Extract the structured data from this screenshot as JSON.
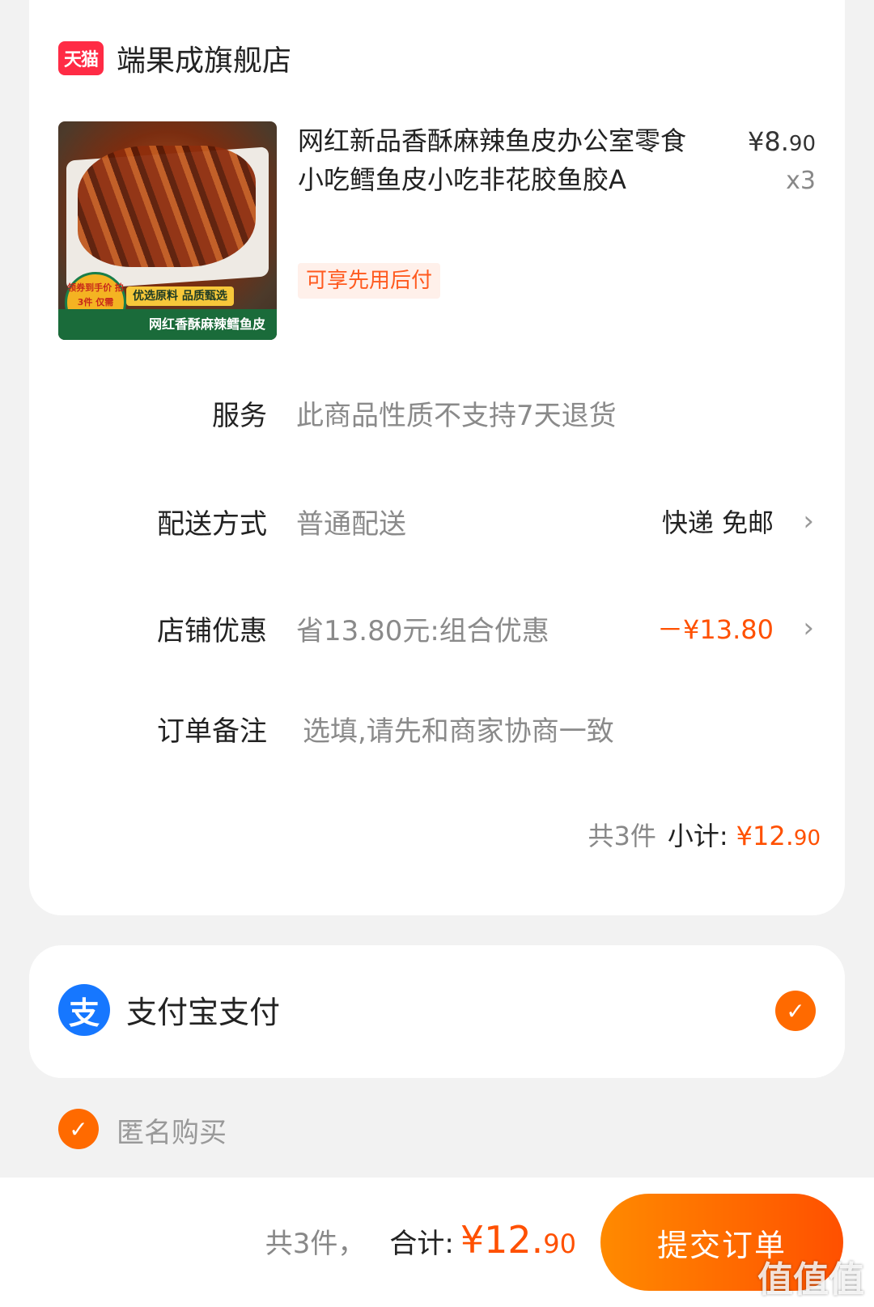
{
  "store": {
    "logo_text": "天猫",
    "name": "端果成旗舰店"
  },
  "product": {
    "title": "网红新品香酥麻辣鱼皮办公室零食小吃鳕鱼皮小吃非花胶鱼胶A",
    "price_yuan": "¥8.",
    "price_cents": "90",
    "quantity": "x3",
    "tag": "可享先用后付",
    "image_badge": "领券到手价 拍3件 仅需12.9",
    "image_tag": "优选原料 品质甄选",
    "image_caption": "网红香酥麻辣鳕鱼皮"
  },
  "rows": {
    "service": {
      "label": "服务",
      "value": "此商品性质不支持7天退货"
    },
    "delivery": {
      "label": "配送方式",
      "value": "普通配送",
      "right": "快递 免邮"
    },
    "discount": {
      "label": "店铺优惠",
      "value": "省13.80元:组合优惠",
      "right": "－¥13.80"
    },
    "note": {
      "label": "订单备注",
      "placeholder": "选填,请先和商家协商一致"
    }
  },
  "subtotal": {
    "count": "共3件",
    "label": "小计:",
    "amount": "¥12.",
    "cents": "90"
  },
  "payment": {
    "icon_text": "支",
    "label": "支付宝支付"
  },
  "anonymous": {
    "label": "匿名购买"
  },
  "bottom": {
    "count": "共3件，",
    "label": "合计:",
    "amount": "¥12.",
    "cents": "90",
    "submit": "提交订单"
  },
  "watermark": "值值值",
  "colors": {
    "accent": "#ff5000",
    "alipay": "#1677ff",
    "tmall": "#ff2b45"
  }
}
